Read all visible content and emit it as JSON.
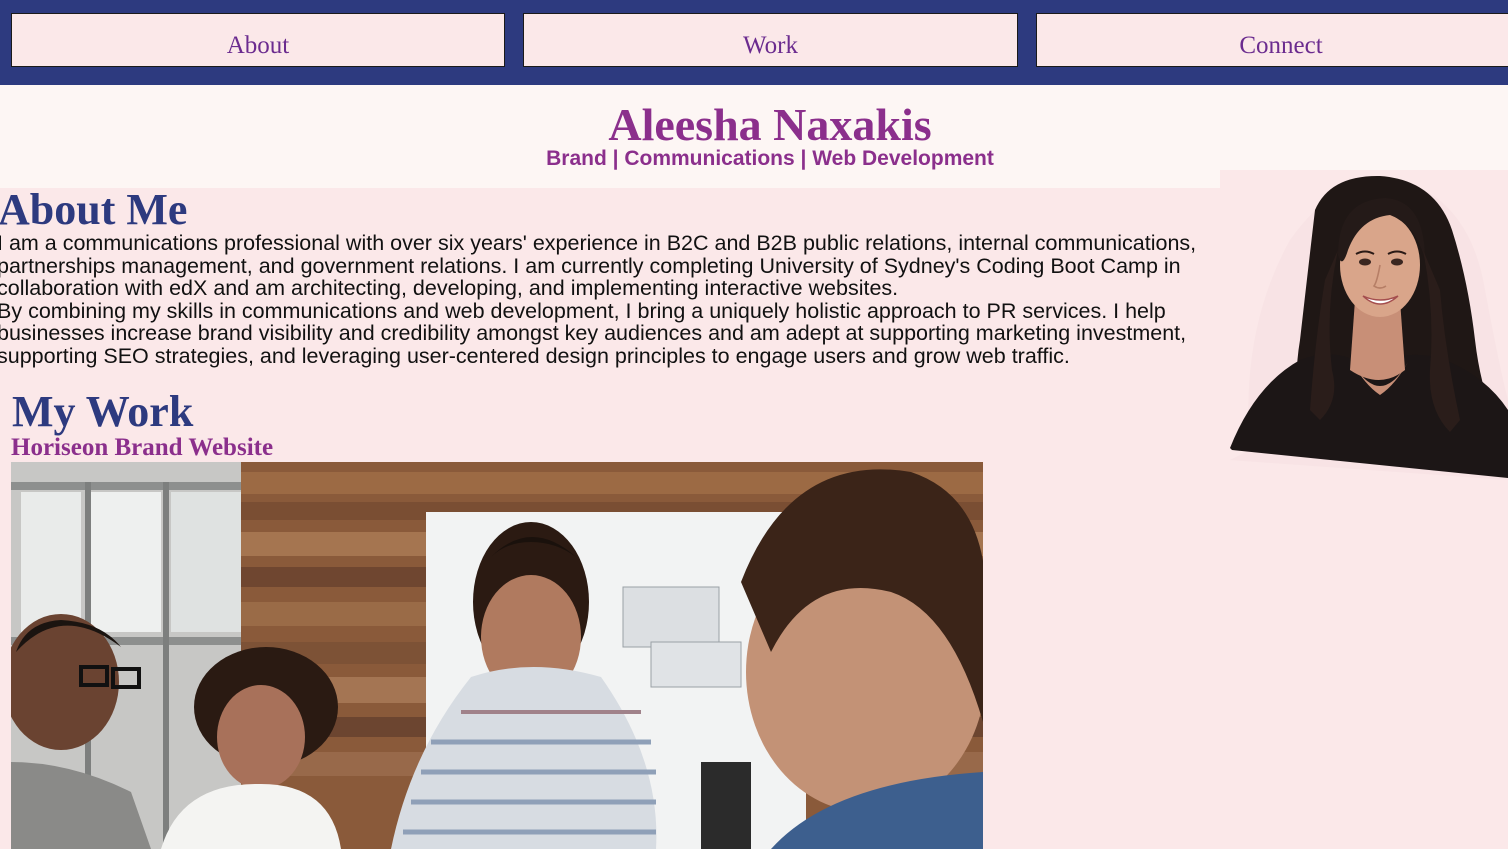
{
  "nav": {
    "items": [
      {
        "label": "About"
      },
      {
        "label": "Work"
      },
      {
        "label": "Connect"
      }
    ]
  },
  "header": {
    "name": "Aleesha Naxakis",
    "tagline": "Brand | Communications | Web Development"
  },
  "about": {
    "title": "About Me",
    "paragraphs": [
      "I am a communications professional with over six years' experience in B2C and B2B public relations, internal communications, partnerships management, and government relations. I am currently completing University of Sydney's Coding Boot Camp in collaboration with edX and am architecting, developing, and implementing interactive websites.",
      "By combining my skills in communications and web development, I bring a uniquely holistic approach to PR services. I help businesses increase brand visibility and credibility amongst key audiences and am adept at supporting marketing investment, supporting SEO strategies, and leveraging user-centered design principles to engage users and grow web traffic."
    ]
  },
  "work": {
    "title": "My Work",
    "projects": [
      {
        "title": "Horiseon Brand Website"
      }
    ]
  },
  "colors": {
    "nav_bg": "#2d3a7f",
    "page_bg": "#fbe8e9",
    "header_bg": "#fdf6f4",
    "accent_purple": "#8b2f8c",
    "heading_navy": "#2d3a7f"
  }
}
